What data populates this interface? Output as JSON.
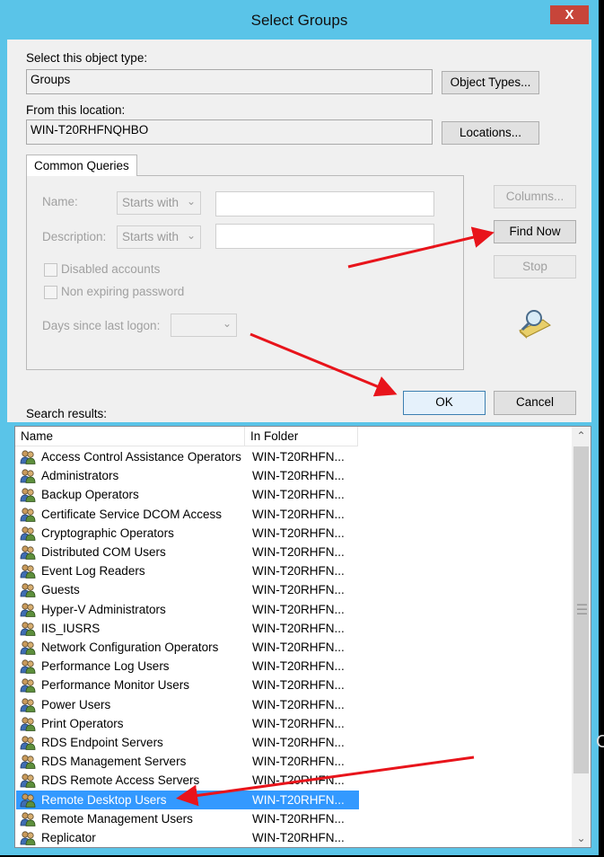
{
  "window": {
    "title": "Select Groups",
    "close_glyph": "X",
    "accent_color": "#5ac4e8",
    "close_color": "#c7453a"
  },
  "object_type": {
    "label": "Select this object type:",
    "value": "Groups",
    "button": "Object Types..."
  },
  "location": {
    "label": "From this location:",
    "value": "WIN-T20RHFNQHBO",
    "button": "Locations..."
  },
  "queries": {
    "tab": "Common Queries",
    "name_label": "Name:",
    "name_mode": "Starts with",
    "name_value": "",
    "desc_label": "Description:",
    "desc_mode": "Starts with",
    "desc_value": "",
    "disabled_label": "Disabled accounts",
    "nonexpiring_label": "Non expiring password",
    "days_label": "Days since last logon:",
    "days_value": ""
  },
  "buttons": {
    "columns": "Columns...",
    "find_now": "Find Now",
    "stop": "Stop",
    "ok": "OK",
    "cancel": "Cancel"
  },
  "results": {
    "label": "Search results:",
    "columns": [
      "Name",
      "In Folder"
    ],
    "selected_color": "#3399ff",
    "rows": [
      {
        "name": "Access Control Assistance Operators",
        "folder": "WIN-T20RHFN..."
      },
      {
        "name": "Administrators",
        "folder": "WIN-T20RHFN..."
      },
      {
        "name": "Backup Operators",
        "folder": "WIN-T20RHFN..."
      },
      {
        "name": "Certificate Service DCOM Access",
        "folder": "WIN-T20RHFN..."
      },
      {
        "name": "Cryptographic Operators",
        "folder": "WIN-T20RHFN..."
      },
      {
        "name": "Distributed COM Users",
        "folder": "WIN-T20RHFN..."
      },
      {
        "name": "Event Log Readers",
        "folder": "WIN-T20RHFN..."
      },
      {
        "name": "Guests",
        "folder": "WIN-T20RHFN..."
      },
      {
        "name": "Hyper-V Administrators",
        "folder": "WIN-T20RHFN..."
      },
      {
        "name": "IIS_IUSRS",
        "folder": "WIN-T20RHFN..."
      },
      {
        "name": "Network Configuration Operators",
        "folder": "WIN-T20RHFN..."
      },
      {
        "name": "Performance Log Users",
        "folder": "WIN-T20RHFN..."
      },
      {
        "name": "Performance Monitor Users",
        "folder": "WIN-T20RHFN..."
      },
      {
        "name": "Power Users",
        "folder": "WIN-T20RHFN..."
      },
      {
        "name": "Print Operators",
        "folder": "WIN-T20RHFN..."
      },
      {
        "name": "RDS Endpoint Servers",
        "folder": "WIN-T20RHFN..."
      },
      {
        "name": "RDS Management Servers",
        "folder": "WIN-T20RHFN..."
      },
      {
        "name": "RDS Remote Access Servers",
        "folder": "WIN-T20RHFN..."
      },
      {
        "name": "Remote Desktop Users",
        "folder": "WIN-T20RHFN...",
        "selected": true
      },
      {
        "name": "Remote Management Users",
        "folder": "WIN-T20RHFN..."
      },
      {
        "name": "Replicator",
        "folder": "WIN-T20RHFN..."
      }
    ]
  },
  "annotation": {
    "arrow_color": "#e8141b"
  },
  "edge_fragment": "C"
}
